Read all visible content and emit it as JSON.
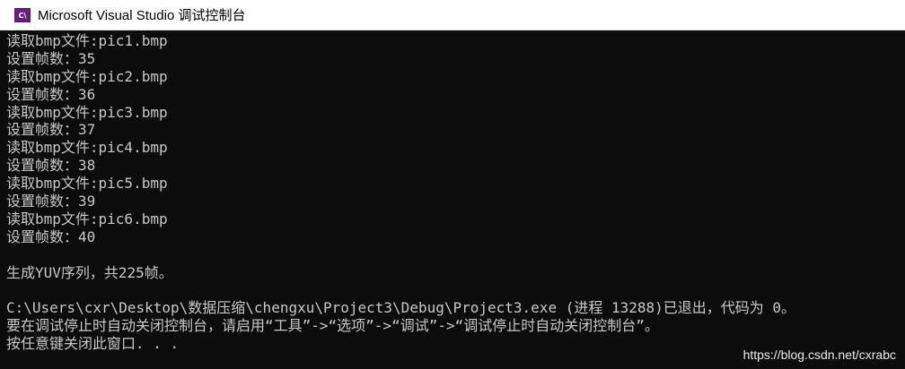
{
  "window": {
    "title": "Microsoft Visual Studio 调试控制台",
    "icon_label": "C\\"
  },
  "console": {
    "lines": [
      "读取bmp文件:pic1.bmp",
      "设置帧数：35",
      "读取bmp文件:pic2.bmp",
      "设置帧数：36",
      "读取bmp文件:pic3.bmp",
      "设置帧数：37",
      "读取bmp文件:pic4.bmp",
      "设置帧数：38",
      "读取bmp文件:pic5.bmp",
      "设置帧数：39",
      "读取bmp文件:pic6.bmp",
      "设置帧数：40",
      "",
      "生成YUV序列，共225帧。",
      "",
      "C:\\Users\\cxr\\Desktop\\数据压缩\\chengxu\\Project3\\Debug\\Project3.exe (进程 13288)已退出，代码为 0。",
      "要在调试停止时自动关闭控制台，请启用“工具”->“选项”->“调试”->“调试停止时自动关闭控制台”。",
      "按任意键关闭此窗口. . ."
    ]
  },
  "watermark": "https://blog.csdn.net/cxrabc",
  "colors": {
    "background": "#0c0c0c",
    "text": "#c8c8c8",
    "titlebar": "#ffffff",
    "icon": "#68217a"
  }
}
